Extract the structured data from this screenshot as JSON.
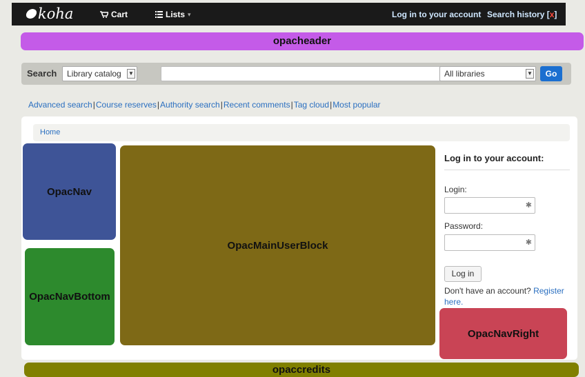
{
  "navbar": {
    "logo": "koha",
    "cart_label": "Cart",
    "lists_label": "Lists",
    "login_link": "Log in to your account",
    "search_history": "Search history",
    "search_history_bracket_open": "[",
    "search_history_clear": "x",
    "search_history_bracket_close": "]"
  },
  "blocks": {
    "opacheader": "opacheader",
    "opacnav": "OpacNav",
    "opacnavbottom": "OpacNavBottom",
    "opacmain": "OpacMainUserBlock",
    "opacnavright": "OpacNavRight",
    "opaccredits": "opaccredits"
  },
  "search": {
    "label": "Search",
    "scope_selected": "Library catalog",
    "query_value": "",
    "library_selected": "All libraries",
    "go_label": "Go"
  },
  "links": [
    "Advanced search",
    "Course reserves",
    "Authority search",
    "Recent comments",
    "Tag cloud",
    "Most popular"
  ],
  "breadcrumb": {
    "home": "Home"
  },
  "login": {
    "title": "Log in to your account:",
    "login_label": "Login:",
    "password_label": "Password:",
    "button_label": "Log in",
    "no_account_text": "Don't have an account?",
    "register_link": "Register here."
  },
  "colors": {
    "opacheader": "#c45be8",
    "opacnav": "#3e5497",
    "opacnavbottom": "#2d8a2d",
    "opacmain": "#7e6916",
    "opacnavright": "#c94455",
    "opaccredits": "#808000",
    "go_button": "#1b6fd0"
  }
}
